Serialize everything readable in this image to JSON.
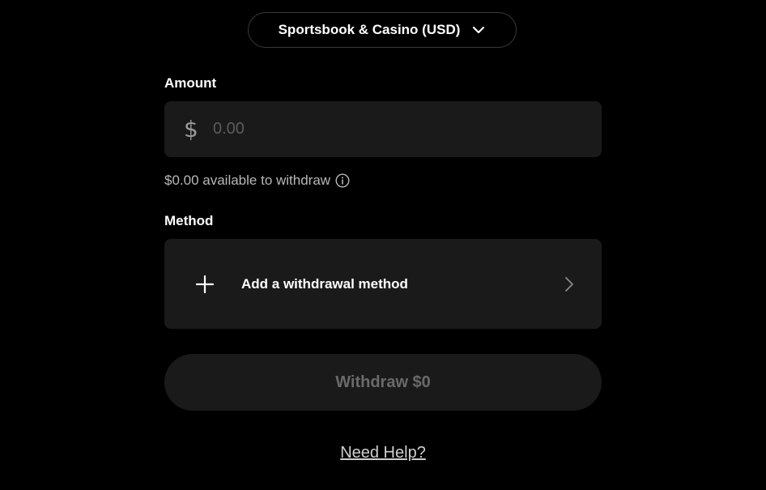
{
  "wallet_selector": {
    "label": "Sportsbook & Casino (USD)",
    "icon": "chevron-down-icon"
  },
  "amount": {
    "label": "Amount",
    "currency_symbol": "$",
    "placeholder": "0.00",
    "value": ""
  },
  "available": {
    "text": "$0.00 available to withdraw",
    "icon": "info-icon"
  },
  "method": {
    "label": "Method",
    "add_label": "Add a withdrawal method",
    "add_icon": "plus-icon",
    "chevron_icon": "chevron-right-icon"
  },
  "withdraw_button": {
    "label": "Withdraw $0",
    "disabled": true
  },
  "help": {
    "label": "Need Help?"
  },
  "colors": {
    "background": "#000000",
    "card": "#1a1a1a",
    "text": "#ffffff",
    "muted_text": "#b8b8b8",
    "disabled_text": "#6a6a6a",
    "border": "#3a3a3a"
  }
}
